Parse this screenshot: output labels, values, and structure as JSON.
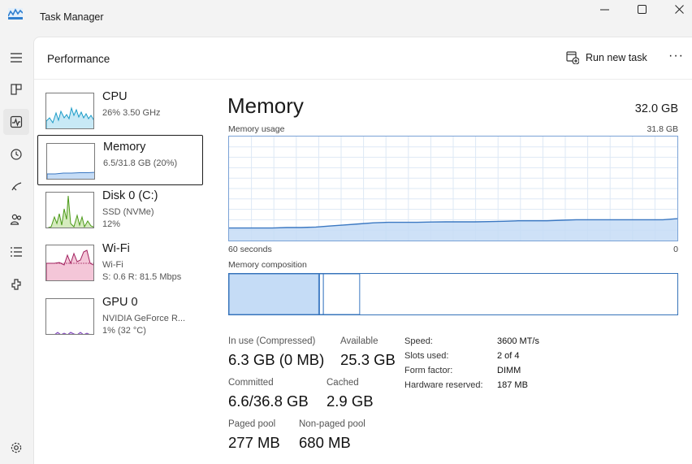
{
  "window": {
    "title": "Task Manager",
    "controls": {
      "minimize": "—",
      "maximize": "☐",
      "close": "✕"
    }
  },
  "nav": {
    "items": [
      {
        "icon": "hamburger-icon"
      },
      {
        "icon": "processes-icon"
      },
      {
        "icon": "performance-icon",
        "active": true
      },
      {
        "icon": "app-history-icon"
      },
      {
        "icon": "startup-apps-icon"
      },
      {
        "icon": "users-icon"
      },
      {
        "icon": "details-icon"
      },
      {
        "icon": "services-icon"
      },
      {
        "icon": "settings-icon"
      }
    ]
  },
  "header": {
    "title": "Performance",
    "run_task_label": "Run new task",
    "more_label": "···"
  },
  "devices": [
    {
      "name": "CPU",
      "sub1": "26%  3.50 GHz",
      "sub2": ""
    },
    {
      "name": "Memory",
      "sub1": "6.5/31.8 GB (20%)",
      "sub2": ""
    },
    {
      "name": "Disk 0 (C:)",
      "sub1": "SSD (NVMe)",
      "sub2": "12%"
    },
    {
      "name": "Wi-Fi",
      "sub1": "Wi-Fi",
      "sub2": "S: 0.6  R: 81.5 Mbps"
    },
    {
      "name": "GPU 0",
      "sub1": "NVIDIA GeForce R...",
      "sub2": "1%  (32 °C)"
    }
  ],
  "memory": {
    "title": "Memory",
    "total": "32.0 GB",
    "usage_label": "Memory usage",
    "usage_max": "31.8 GB",
    "time_left": "60 seconds",
    "time_right": "0",
    "composition_label": "Memory composition",
    "composition": {
      "in_use": 0.2,
      "modified": 0.005,
      "standby": 0.09
    },
    "usage_series": [
      0.12,
      0.12,
      0.12,
      0.12,
      0.125,
      0.125,
      0.13,
      0.14,
      0.15,
      0.16,
      0.17,
      0.175,
      0.175,
      0.175,
      0.178,
      0.18,
      0.18,
      0.18,
      0.182,
      0.185,
      0.19,
      0.19,
      0.19,
      0.195,
      0.2,
      0.2,
      0.2,
      0.2,
      0.2,
      0.2,
      0.2,
      0.21
    ],
    "stats": {
      "in_use_label": "In use (Compressed)",
      "in_use_value": "6.3 GB (0 MB)",
      "available_label": "Available",
      "available_value": "25.3 GB",
      "committed_label": "Committed",
      "committed_value": "6.6/36.8 GB",
      "cached_label": "Cached",
      "cached_value": "2.9 GB",
      "paged_label": "Paged pool",
      "paged_value": "277 MB",
      "nonpaged_label": "Non-paged pool",
      "nonpaged_value": "680 MB"
    },
    "details": [
      {
        "key": "Speed:",
        "value": "3600 MT/s"
      },
      {
        "key": "Slots used:",
        "value": "2 of 4"
      },
      {
        "key": "Form factor:",
        "value": "DIMM"
      },
      {
        "key": "Hardware reserved:",
        "value": "187 MB"
      }
    ]
  },
  "colors": {
    "memory_line": "#3b78c2",
    "memory_fill": "#c5dcf6",
    "cpu_line": "#1b9bc7",
    "disk_line": "#4c9a1a",
    "wifi_line": "#a2225f",
    "gpu_line": "#7a3fb5"
  }
}
